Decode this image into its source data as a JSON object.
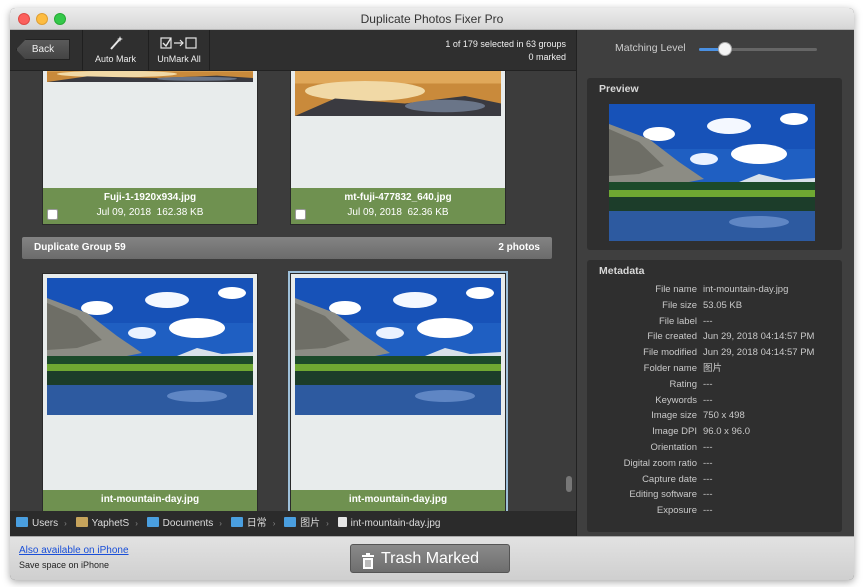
{
  "window": {
    "title": "Duplicate Photos Fixer Pro"
  },
  "toolbar": {
    "back_label": "Back",
    "auto_mark_label": "Auto Mark",
    "unmark_all_label": "UnMark All",
    "selection_status": "1 of 179 selected in 63 groups",
    "marked_status": "0 marked"
  },
  "groups": [
    {
      "items": [
        {
          "file_name": "Fuji-1-1920x934.jpg",
          "date": "Jul 09, 2018",
          "size": "162.38 KB",
          "checked": false
        },
        {
          "file_name": "mt-fuji-477832_640.jpg",
          "date": "Jul 09, 2018",
          "size": "62.36 KB",
          "checked": false
        }
      ]
    },
    {
      "title": "Duplicate Group 59",
      "count_label": "2 photos",
      "items": [
        {
          "file_name": "int-mountain-day.jpg"
        },
        {
          "file_name": "int-mountain-day.jpg",
          "selected": true
        }
      ]
    }
  ],
  "path": [
    "Users",
    "YaphetS",
    "Documents",
    "日常",
    "图片",
    "int-mountain-day.jpg"
  ],
  "right_panel": {
    "matching_level_label": "Matching Level",
    "matching_level": 0.22,
    "preview_title": "Preview",
    "metadata_title": "Metadata",
    "metadata": [
      {
        "key": "File name",
        "value": "int-mountain-day.jpg"
      },
      {
        "key": "File size",
        "value": "53.05 KB"
      },
      {
        "key": "File label",
        "value": "---"
      },
      {
        "key": "File created",
        "value": "Jun 29, 2018 04:14:57 PM"
      },
      {
        "key": "File modified",
        "value": "Jun 29, 2018 04:14:57 PM"
      },
      {
        "key": "Folder name",
        "value": "图片"
      },
      {
        "key": "Rating",
        "value": "---"
      },
      {
        "key": "Keywords",
        "value": "---"
      },
      {
        "key": "Image size",
        "value": "750 x 498"
      },
      {
        "key": "Image DPI",
        "value": "96.0 x 96.0"
      },
      {
        "key": "Orientation",
        "value": "---"
      },
      {
        "key": "Digital zoom ratio",
        "value": "---"
      },
      {
        "key": "Capture date",
        "value": "---"
      },
      {
        "key": "Editing software",
        "value": "---"
      },
      {
        "key": "Exposure",
        "value": "---"
      }
    ]
  },
  "bottom": {
    "iphone_link": "Also available on iPhone",
    "iphone_sub": "Save space on iPhone",
    "trash_label": "Trash Marked"
  },
  "colors": {
    "accent": "#4a90e2",
    "card_footer": "#6f9150",
    "link": "#1a4fd8"
  }
}
